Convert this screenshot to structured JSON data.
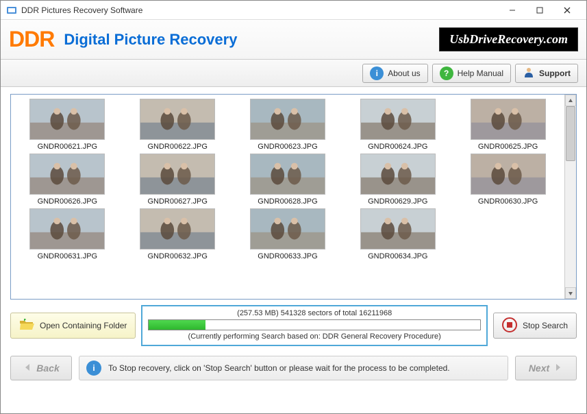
{
  "window": {
    "title": "DDR Pictures Recovery Software"
  },
  "header": {
    "logo_text": "DDR",
    "title": "Digital Picture Recovery",
    "brand": "UsbDriveRecovery.com"
  },
  "toolbar": {
    "about_label": "About us",
    "help_label": "Help Manual",
    "support_label": "Support"
  },
  "thumbnails": [
    {
      "filename": "GNDR00621.JPG"
    },
    {
      "filename": "GNDR00622.JPG"
    },
    {
      "filename": "GNDR00623.JPG"
    },
    {
      "filename": "GNDR00624.JPG"
    },
    {
      "filename": "GNDR00625.JPG"
    },
    {
      "filename": "GNDR00626.JPG"
    },
    {
      "filename": "GNDR00627.JPG"
    },
    {
      "filename": "GNDR00628.JPG"
    },
    {
      "filename": "GNDR00629.JPG"
    },
    {
      "filename": "GNDR00630.JPG"
    },
    {
      "filename": "GNDR00631.JPG"
    },
    {
      "filename": "GNDR00632.JPG"
    },
    {
      "filename": "GNDR00633.JPG"
    },
    {
      "filename": "GNDR00634.JPG"
    }
  ],
  "actions": {
    "open_folder_label": "Open Containing Folder",
    "stop_label": "Stop Search"
  },
  "progress": {
    "size_mb": "257.53 MB",
    "sectors_done": 541328,
    "sectors_total": 16211968,
    "top_text": "(257.53 MB) 541328   sectors  of  total 16211968",
    "sub_text": "(Currently performing Search based on:  DDR General Recovery Procedure)",
    "percent": 17
  },
  "footer": {
    "back_label": "Back",
    "next_label": "Next",
    "info_text": "To Stop recovery, click on 'Stop Search' button or please wait for the process to be completed."
  }
}
